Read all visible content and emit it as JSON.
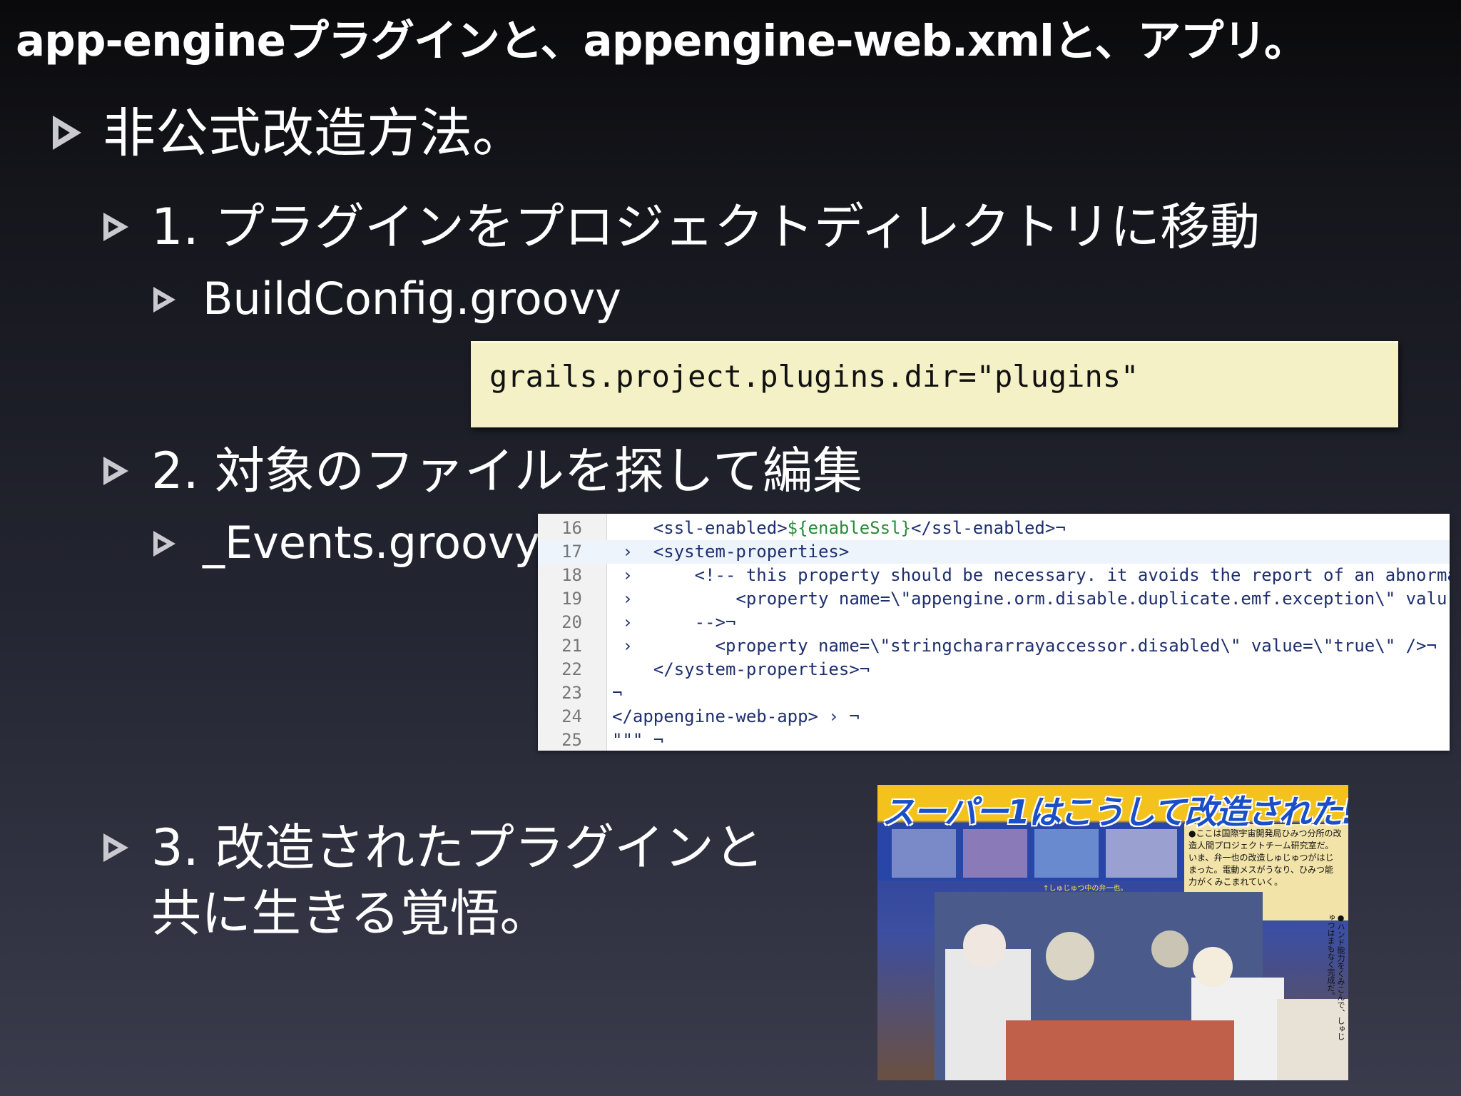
{
  "slide": {
    "title": "app-engineプラグインと、appengine-web.xmlと、アプリ。"
  },
  "bullets": {
    "main": "非公式改造方法。",
    "step1": "1. プラグインをプロジェクトディレクトリに移動",
    "step1_file": "BuildConfig.groovy",
    "step2": "2. 対象のファイルを探して編集",
    "step2_file": "_Events.groovy",
    "step3_line1": "3. 改造されたプラグインと",
    "step3_line2": "共に生きる覚悟。"
  },
  "note": {
    "code": "grails.project.plugins.dir=\"plugins\""
  },
  "editor": {
    "lines": [
      {
        "num": "16",
        "pre": "    <ssl-enabled>",
        "hl": "${enableSsl}",
        "post": "</ssl-enabled>¬"
      },
      {
        "num": "17",
        "pre": " ›  <system-properties>",
        "hl": "",
        "post": ""
      },
      {
        "num": "18",
        "pre": " ›      <!-- this property should be necessary. it avoids the report of an abnorma",
        "hl": "",
        "post": ""
      },
      {
        "num": "19",
        "pre": " ›          <property name=\\\"appengine.orm.disable.duplicate.emf.exception\\\" valu",
        "hl": "",
        "post": ""
      },
      {
        "num": "20",
        "pre": " ›      -->¬",
        "hl": "",
        "post": ""
      },
      {
        "num": "21",
        "pre": " ›        <property name=\\\"stringchararrayaccessor.disabled\\\" value=\\\"true\\\" />¬",
        "hl": "",
        "post": ""
      },
      {
        "num": "22",
        "pre": "    </system-properties>¬",
        "hl": "",
        "post": ""
      },
      {
        "num": "23",
        "pre": "¬",
        "hl": "",
        "post": ""
      },
      {
        "num": "24",
        "pre": "</appengine-web-app> › ¬",
        "hl": "",
        "post": ""
      },
      {
        "num": "25",
        "pre": "\"\"\" ¬",
        "hl": "",
        "post": ""
      }
    ]
  },
  "photo": {
    "title": "スーパー1はこうして改造された!",
    "caption": "●ここは国際宇宙開発局ひみつ分所の改造人間プロジェクトチーム研究室だ。いま、弁一也の改造しゅじゅつがはじまった。電動メスがうなり、ひみつ能力がくみこまれていく。",
    "small": "↑しゅじゅつ中の弁一也。",
    "side": "●ハンド能力をくみこんで、しゅじゅつはまもなく完成だ。"
  }
}
